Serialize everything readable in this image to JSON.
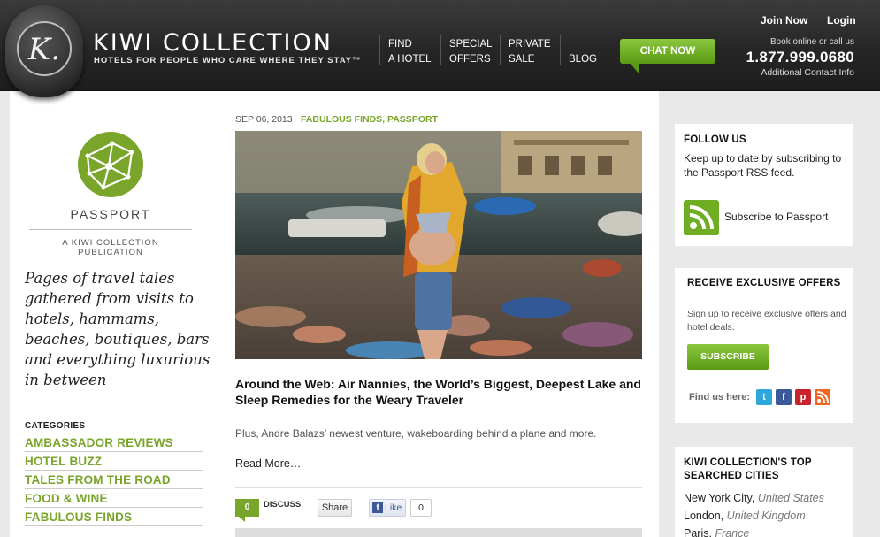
{
  "header": {
    "logo_letter": "K.",
    "brand_title": "KIWI COLLECTION",
    "brand_tagline": "HOTELS FOR PEOPLE WHO CARE WHERE THEY STAY™",
    "nav": [
      {
        "line1": "FIND",
        "line2": "A HOTEL"
      },
      {
        "line1": "SPECIAL",
        "line2": "OFFERS"
      },
      {
        "line1": "PRIVATE",
        "line2": "SALE"
      },
      {
        "line1": "BLOG",
        "line2": ""
      }
    ],
    "chat_label": "CHAT NOW",
    "join_label": "Join Now",
    "login_label": "Login",
    "book_text": "Book online or call us",
    "phone": "1.877.999.0680",
    "contact_link": "Additional Contact Info"
  },
  "sidebar": {
    "passport_title": "PASSPORT",
    "publication": "A KIWI COLLECTION PUBLICATION",
    "intro": "Pages of travel tales gathered from visits to hotels, hammams, beaches, boutiques, bars and everything luxurious in between",
    "categories_heading": "CATEGORIES",
    "categories": [
      "AMBASSADOR REVIEWS",
      "HOTEL BUZZ",
      "TALES FROM THE ROAD",
      "FOOD & WINE",
      "FABULOUS FINDS"
    ]
  },
  "post": {
    "date": "SEP 06, 2013",
    "categories": "FABULOUS FINDS, PASSPORT",
    "title": "Around the Web: Air Nannies, the World’s Biggest, Deepest Lake and Sleep Remedies for the Weary Traveler",
    "excerpt": "Plus, Andre Balazs’ newest venture, wakeboarding behind a plane and more.",
    "read_more": "Read More…",
    "comment_count": "0",
    "discuss_label": "DISCUSS",
    "share_label": "Share",
    "like_label": "Like",
    "like_count": "0"
  },
  "follow": {
    "title": "FOLLOW US",
    "text": "Keep up to date by subscribing to the Passport RSS feed.",
    "rss_label": "Subscribe to Passport"
  },
  "offers": {
    "title": "RECEIVE EXCLUSIVE OFFERS",
    "text": "Sign up to receive exclusive offers and hotel deals.",
    "subscribe_label": "SUBSCRIBE",
    "find_us": "Find us here:",
    "social": [
      {
        "icon": "twitter-icon",
        "glyph": "t",
        "color": "#2fa7d9"
      },
      {
        "icon": "facebook-icon",
        "glyph": "f",
        "color": "#3b5998"
      },
      {
        "icon": "pinterest-icon",
        "glyph": "p",
        "color": "#c8232c"
      },
      {
        "icon": "rss-icon",
        "glyph": "",
        "color": "#f26522"
      }
    ]
  },
  "top_cities": {
    "title_line1": "KIWI COLLECTION'S TOP",
    "title_line2": "SEARCHED CITIES",
    "cities": [
      {
        "city": "New York City",
        "country": "United States"
      },
      {
        "city": "London",
        "country": "United Kingdom"
      },
      {
        "city": "Paris",
        "country": "France"
      }
    ]
  },
  "colors": {
    "accent_green": "#79a52b",
    "header_bg": "#262626",
    "button_green": "#5a9a13"
  }
}
